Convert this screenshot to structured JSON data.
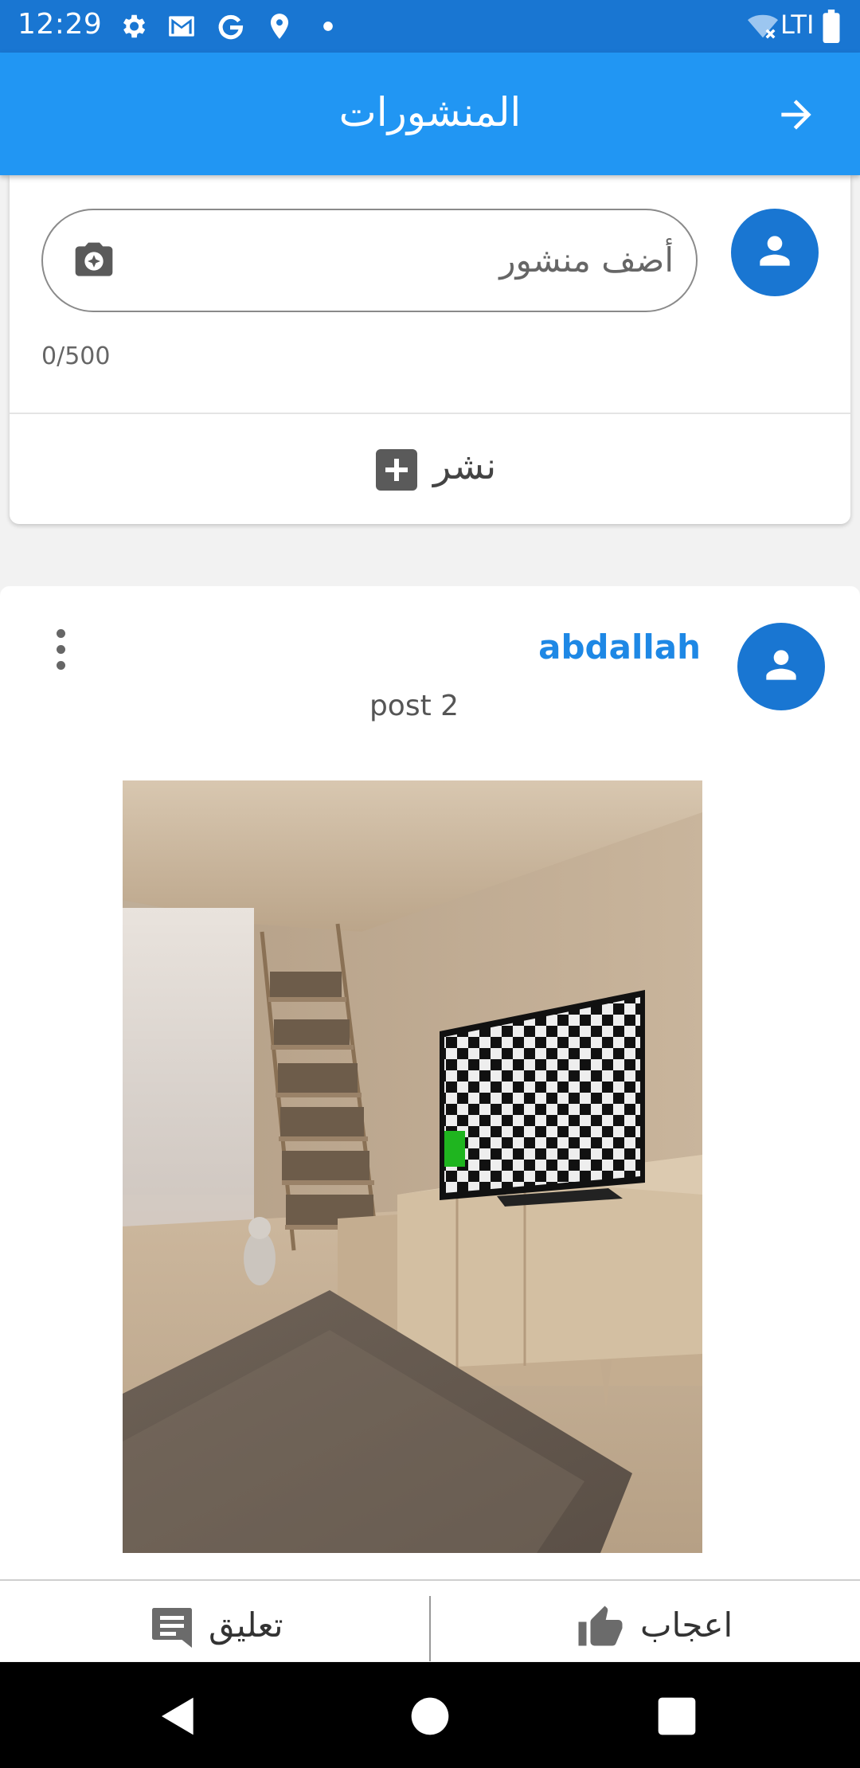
{
  "status_bar": {
    "time": "12:29",
    "left_icons": [
      "gear-icon",
      "gmail-icon",
      "google-icon",
      "location-icon",
      "dot-icon"
    ],
    "right_icons": [
      "wifi-off-icon",
      "signal-icon",
      "battery-icon"
    ],
    "network": "LTI"
  },
  "app_bar": {
    "title": "المنشورات",
    "back_icon": "arrow-forward-icon",
    "color": "#2196f3"
  },
  "composer": {
    "placeholder": "أضف منشور",
    "counter": "0/500",
    "publish_label": "نشر",
    "publish_icon": "add-box-icon",
    "camera_icon": "add-photo-icon",
    "avatar_icon": "person-icon"
  },
  "post": {
    "author": "abdallah",
    "text": "post 2",
    "menu_icon": "more-vert-icon",
    "image_description": "wooden room with tv showing checkerboard",
    "actions": {
      "like_label": "اعجاب",
      "comment_label": "تعليق"
    }
  },
  "nav_bar": {
    "icons": [
      "back-triangle-icon",
      "home-circle-icon",
      "recents-square-icon"
    ]
  },
  "colors": {
    "status_bar": "#1976d2",
    "accent": "#1e88e5",
    "avatar": "#1976d2"
  }
}
